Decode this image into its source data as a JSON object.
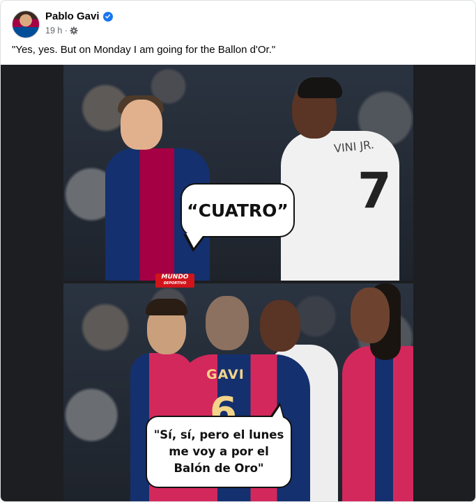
{
  "post": {
    "author": "Pablo Gavi",
    "timestamp": "19 h ·",
    "caption": "\"Yes, yes. But on Monday I am going for the Ballon d'Or.\"",
    "verified_icon": "verified-badge-icon",
    "audience_icon": "gear-icon"
  },
  "meme": {
    "top_bubble": "“CUATRO”",
    "bottom_bubble": "\"Sí, sí, pero el lunes me voy a por el Balón de Oro\"",
    "logo_main": "MUNDO",
    "logo_sub": "DEPORTIVO",
    "jersey_name_top": "VINI JR.",
    "jersey_number_top": "7",
    "jersey_name_bottom": "GAVI",
    "jersey_number_bottom": "6"
  },
  "colors": {
    "barca_blue": "#14306e",
    "barca_red": "#a50044",
    "verified_blue": "#1877f2",
    "logo_red": "#d1141b"
  }
}
